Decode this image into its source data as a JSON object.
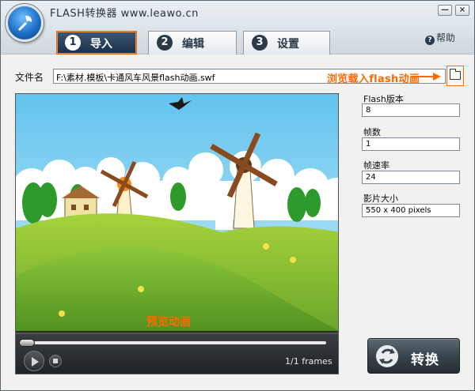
{
  "app": {
    "title": "FLASH转换器 www.leawo.cn",
    "min_label": "—",
    "close_label": "×"
  },
  "tabs": [
    {
      "num": "1",
      "label": "导入",
      "active": true
    },
    {
      "num": "2",
      "label": "编辑",
      "active": false
    },
    {
      "num": "3",
      "label": "设置",
      "active": false
    }
  ],
  "help": {
    "label": "帮助",
    "icon": "question-icon"
  },
  "file": {
    "label": "文件名",
    "path": "F:\\素材.模板\\卡通风车风景flash动画.swf",
    "browse_hint": "浏览载入flash动画",
    "browse_icon": "folder-open-icon"
  },
  "preview": {
    "label": "预览动画",
    "frames": "1/1 frames"
  },
  "properties": {
    "version_label": "Flash版本",
    "version_value": "8",
    "frame_count_label": "帧数",
    "frame_count_value": "1",
    "frame_rate_label": "帧速率",
    "frame_rate_value": "24",
    "size_label": "影片大小",
    "size_value": "550 x 400 pixels"
  },
  "convert": {
    "label": "转换",
    "icon": "convert-arrows-icon"
  },
  "colors": {
    "accent": "#ff6a00",
    "tab_active": "#1b2f47"
  }
}
